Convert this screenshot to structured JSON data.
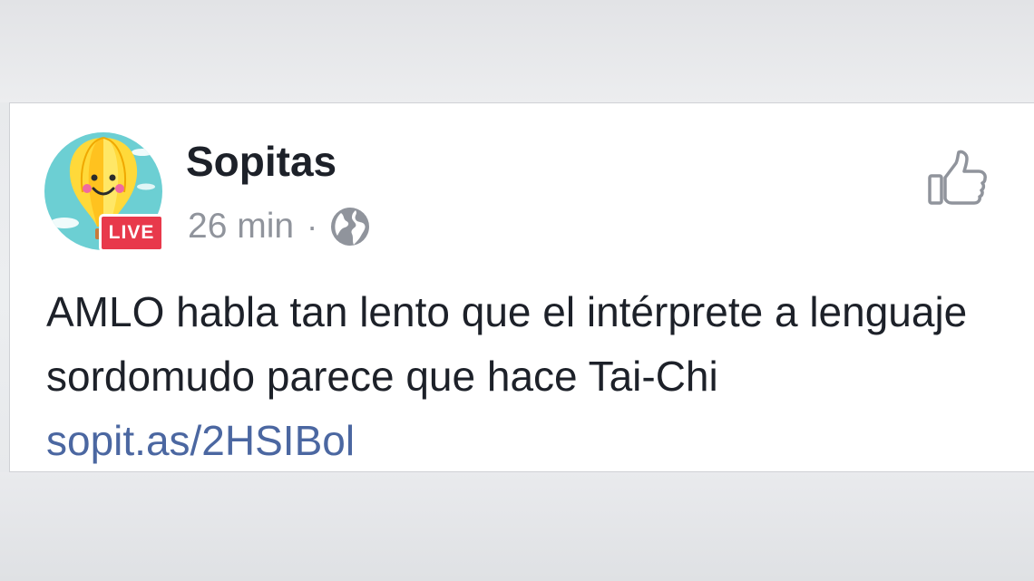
{
  "post": {
    "page_name": "Sopitas",
    "live_badge": "LIVE",
    "timestamp": "26 min",
    "separator": "·",
    "audience_icon": "globe-icon",
    "text": "AMLO habla tan lento que el intérprete a lenguaje sordomudo parece que hace Tai-Chi",
    "link_text": "sopit.as/2HSIBol",
    "avatar_icon": "smiling-hot-air-balloon-avatar",
    "like_icon": "thumbs-up-icon"
  },
  "colors": {
    "text": "#1d2129",
    "meta": "#90949c",
    "link": "#4b67a1",
    "live_badge": "#e8394b",
    "background": "#e9eaed",
    "card": "#ffffff"
  }
}
